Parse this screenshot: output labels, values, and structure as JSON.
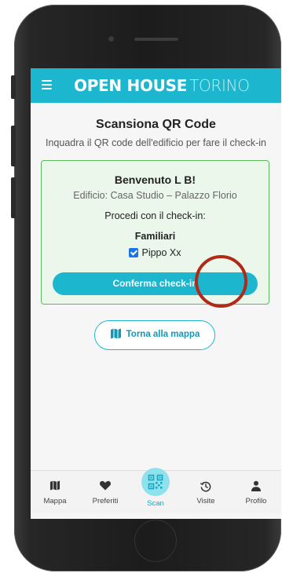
{
  "header": {
    "brand_bold": "OPEN HOUSE",
    "brand_light": "TORINO",
    "menu_icon": "hamburger-menu-icon",
    "color": "#1cb6cf"
  },
  "page": {
    "title": "Scansiona QR Code",
    "subtitle": "Inquadra il QR code dell'edificio per fare il check-in"
  },
  "checkin_card": {
    "welcome": "Benvenuto L B!",
    "building": "Edificio: Casa Studio – Palazzo Florio",
    "proceed": "Procedi con il check-in:",
    "group_label": "Familiari",
    "members": [
      {
        "name": "Pippo Xx",
        "checked": true
      }
    ],
    "confirm_label": "Conferma check-in",
    "border_color": "#5cb85c",
    "background": "#eaf7ea"
  },
  "back_button": {
    "label": "Torna alla mappa",
    "icon": "map-icon"
  },
  "tabbar": {
    "items": [
      {
        "label": "Mappa",
        "icon": "map-icon",
        "active": false
      },
      {
        "label": "Preferiti",
        "icon": "heart-icon",
        "active": false
      },
      {
        "label": "Scan",
        "icon": "qr-code-icon",
        "active": true
      },
      {
        "label": "Visite",
        "icon": "history-icon",
        "active": false
      },
      {
        "label": "Profilo",
        "icon": "person-icon",
        "active": false
      }
    ]
  },
  "annotation": {
    "color": "#b02a17"
  }
}
